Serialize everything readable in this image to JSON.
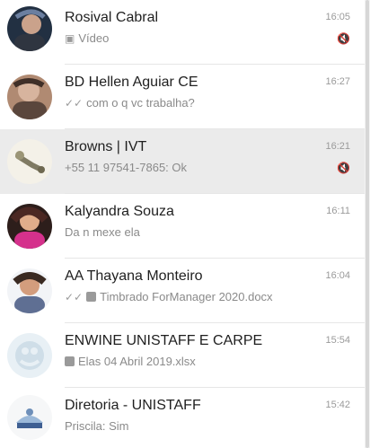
{
  "chats": [
    {
      "name": "Rosival Cabral",
      "time": "16:05",
      "preview": "Vídeo",
      "muted": true,
      "tick": "",
      "file": false
    },
    {
      "name": "BD Hellen Aguiar CE",
      "time": "16:27",
      "preview": "com o q vc trabalha?",
      "muted": false,
      "tick": "✓✓",
      "file": false
    },
    {
      "name": "Browns | IVT",
      "time": "16:21",
      "preview": "+55 11 97541-7865: Ok",
      "muted": true,
      "tick": "",
      "file": false
    },
    {
      "name": "Kalyandra Souza",
      "time": "16:11",
      "preview": "Da n mexe ela",
      "muted": false,
      "tick": "",
      "file": false
    },
    {
      "name": "AA Thayana Monteiro",
      "time": "16:04",
      "preview": "Timbrado ForManager 2020.docx",
      "muted": false,
      "tick": "✓✓",
      "file": true
    },
    {
      "name": "ENWINE UNISTAFF E CARPE",
      "time": "15:54",
      "preview": "Elas 04 Abril 2019.xlsx",
      "muted": false,
      "tick": "",
      "file": true
    },
    {
      "name": "Diretoria - UNISTAFF",
      "time": "15:42",
      "preview": "Priscila: Sim",
      "muted": false,
      "tick": "",
      "file": false
    }
  ],
  "colors": {
    "selected_bg": "#ebebeb",
    "avatar_browns": "#f4f1e8",
    "avatar_group": "#e8f0f5"
  }
}
